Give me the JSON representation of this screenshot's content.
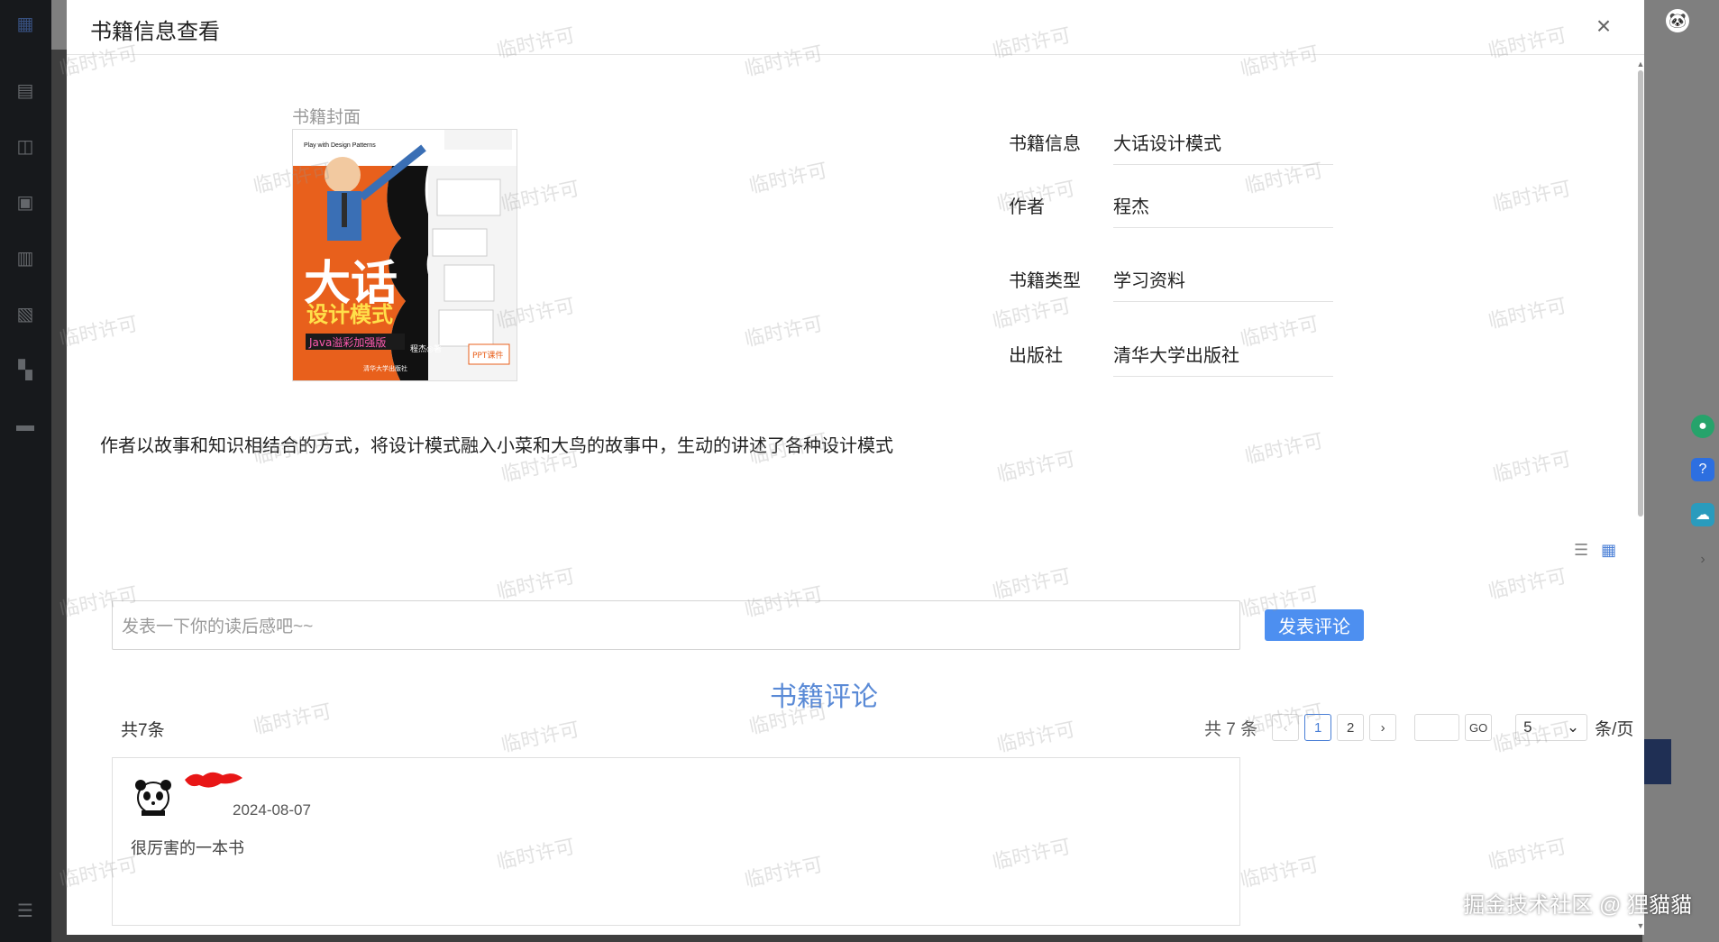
{
  "dialog": {
    "title": "书籍信息查看",
    "close_icon": "close-icon"
  },
  "cover": {
    "label": "书籍封面",
    "art": {
      "top_left": "Play with Design Patterns",
      "big_title": "大话",
      "subtitle": "设计模式",
      "edition": "Java溢彩加强版",
      "author_line": "程杰◎著",
      "publisher_line": "清华大学出版社",
      "badge": "PPT课件"
    }
  },
  "info": {
    "book_label": "书籍信息",
    "book_value": "大话设计模式",
    "author_label": "作者",
    "author_value": "程杰",
    "type_label": "书籍类型",
    "type_value": "学习资料",
    "publisher_label": "出版社",
    "publisher_value": "清华大学出版社"
  },
  "description": "作者以故事和知识相结合的方式，将设计模式融入小菜和大鸟的故事中，生动的讲述了各种设计模式",
  "view_toggle": [
    "list-icon",
    "grid-icon"
  ],
  "comment_form": {
    "placeholder": "发表一下你的读后感吧~~",
    "submit_label": "发表评论"
  },
  "reviews": {
    "title": "书籍评论",
    "total_left": "共7条",
    "pagination": {
      "total": "共 7 条",
      "pages": [
        "1",
        "2"
      ],
      "current_page": "1",
      "go_label": "GO",
      "page_size": "5",
      "unit": "条/页"
    },
    "items": [
      {
        "date": "2024-08-07",
        "text": "很厉害的一本书"
      }
    ]
  },
  "watermark_text": "临时许可",
  "site_watermark": "掘金技术社区 @ 狸貓貓",
  "colors": {
    "accent": "#4d8ff0",
    "title_blue": "#5a8ad6",
    "sidebar": "#2f3339"
  }
}
